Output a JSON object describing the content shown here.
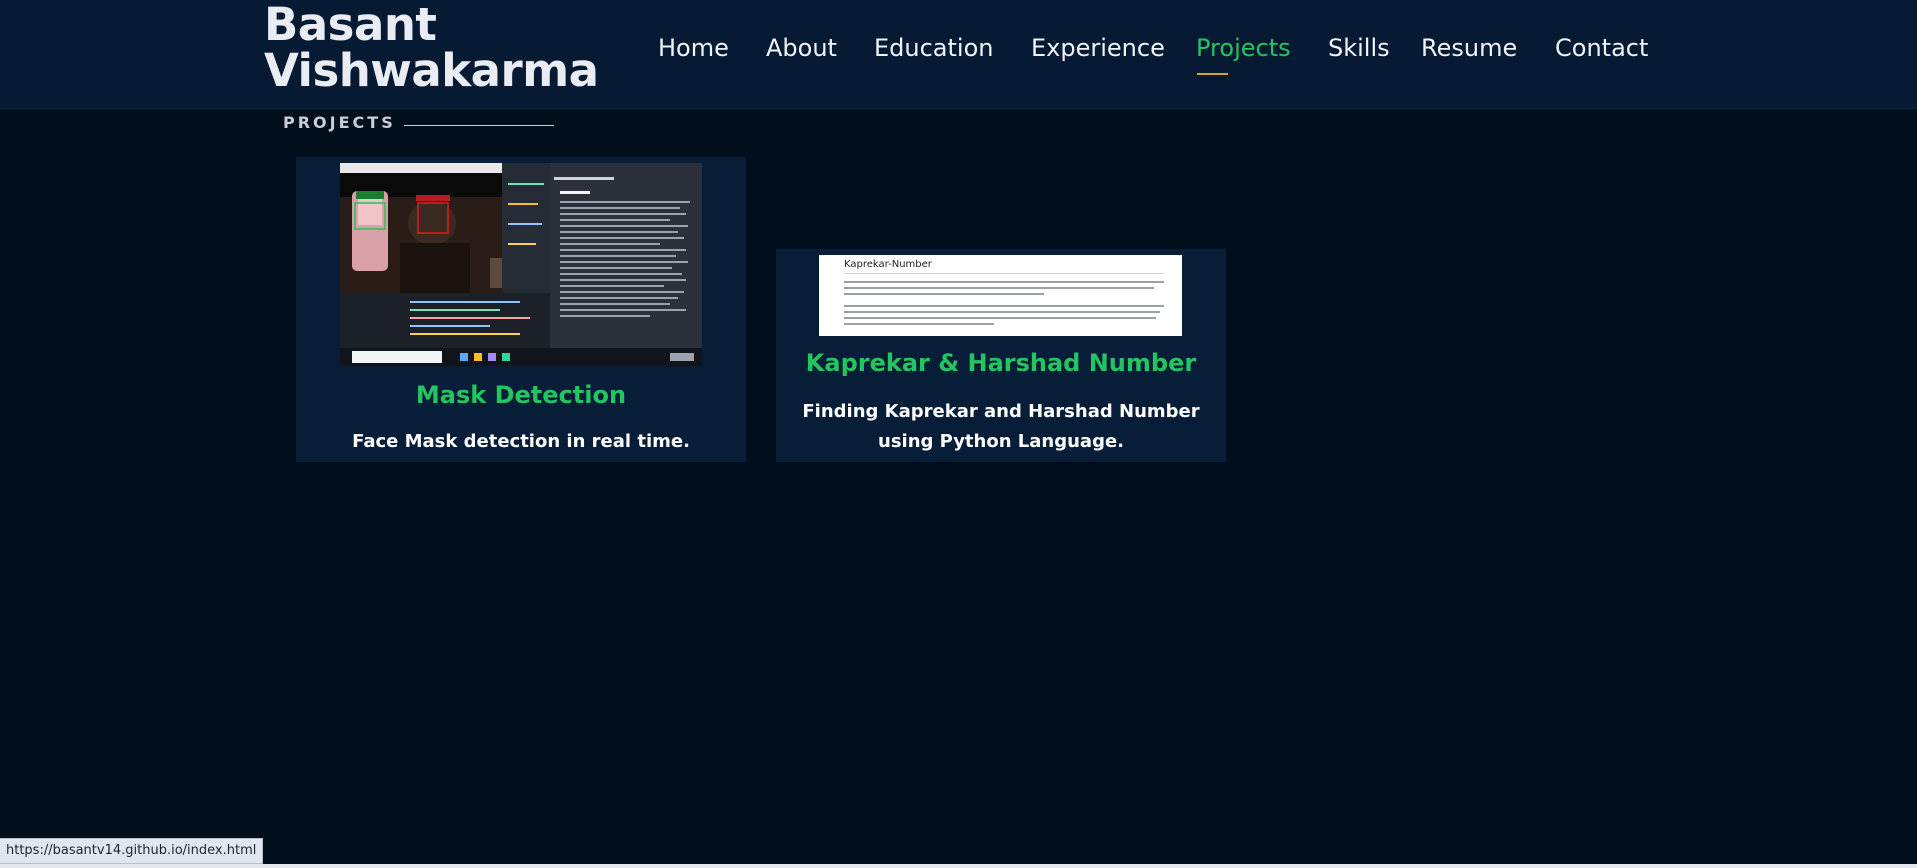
{
  "brand": {
    "line1": "Basant",
    "line2": "Vishwakarma"
  },
  "nav": {
    "items": [
      {
        "label": "Home"
      },
      {
        "label": "About"
      },
      {
        "label": "Education"
      },
      {
        "label": "Experience"
      },
      {
        "label": "Projects",
        "active": true
      },
      {
        "label": "Skills"
      },
      {
        "label": "Resume"
      },
      {
        "label": "Contact"
      }
    ]
  },
  "section": {
    "heading": "PROJECTS"
  },
  "projects": [
    {
      "title": "Mask Detection",
      "description": "Face Mask detection in real time.",
      "image_icon": "mask-detection-screenshot"
    },
    {
      "title": "Kaprekar & Harshad Number",
      "description": "Finding Kaprekar and Harshad Number using Python Language.",
      "image_icon": "kaprekar-document-screenshot",
      "image_heading": "Kaprekar-Number"
    }
  ],
  "status_bar": {
    "url": "https://basantv14.github.io/index.html"
  },
  "colors": {
    "accent": "#22c55e",
    "nav_bg": "#071a33",
    "page_bg": "#010f1c",
    "underline": "#d4a52a"
  }
}
